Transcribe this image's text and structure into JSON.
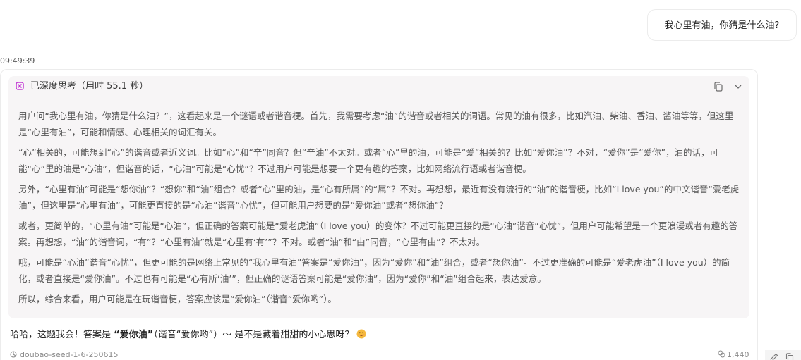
{
  "user_message": {
    "text": "我心里有油，你猜是什么油?"
  },
  "timestamp": "09:49:39",
  "thinking": {
    "label": "已深度思考（用时 55.1 秒）",
    "icon": "deep-thinking-icon",
    "paragraphs": [
      "用户问“我心里有油，你猜是什么油？”，这看起来是一个谜语或者谐音梗。首先，我需要考虑“油”的谐音或者相关的词语。常见的油有很多，比如汽油、柴油、香油、酱油等等，但这里是“心里有油”，可能和情感、心理相关的词汇有关。",
      "“心”相关的，可能想到“心”的谐音或者近义词。比如“心”和“辛”同音？但“辛油”不太对。或者“心”里的油，可能是“爱”相关的？比如“爱你油”？不对，“爱你”是“爱你”，油的话，可能“心”里的油是“心油”，但谐音的话，“心油”可能是“心忧”？不过用户可能是想要一个更有趣的答案，比如网络流行语或者谐音梗。",
      "另外，“心里有油”可能是“想你油”？“想你”和“油”组合？或者“心”里的油，是“心有所属”的“属”？不对。再想想，最近有没有流行的“油”的谐音梗，比如“I love you”的中文谐音“爱老虎油”，但这里是“心里有油”，可能更直接的是“心油”谐音“心忧”，但可能用户想要的是“爱你油”或者“想你油”？",
      "或者，更简单的，“心里有油”可能是“心油”，但正确的答案可能是“爱老虎油”（I love you）的变体？不过可能更直接的是“心油”谐音“心忧”，但用户可能希望是一个更浪漫或者有趣的答案。再想想，“油”的谐音词，“有”？“心里有油”就是“心里有‘有’”？不对。或者“油”和“由”同音，“心里有由”？不太对。",
      "哦，可能是“心油”谐音“心忧”，但更可能的是网络上常见的“我心里有油”答案是“爱你油”，因为“爱你”和“油”组合，或者“想你油”。不过更准确的可能是“爱老虎油”（I love you）的简化，或者直接是“爱你油”。不过也有可能是“心有所‘油’”，但正确的谜语答案可能是“爱你油”，因为“爱你”和“油”组合起来，表达爱意。",
      "所以，综合来看，用户可能是在玩谐音梗，答案应该是“爱你油”（谐音“爱你哟”）。"
    ]
  },
  "answer": {
    "prefix": "哈哈，这题我会！答案是 ",
    "highlight": "“爱你油”",
    "suffix": "（谐音“爱你哟”）～ 是不是藏着甜甜的小心思呀？",
    "emoji": "grinning-face-icon"
  },
  "footer": {
    "model": "doubao-seed-1-6-250615",
    "token_count": "1,440"
  },
  "colors": {
    "thinking_bg": "#f7f5f6",
    "thinking_icon": "#c23bd4",
    "thinking_text": "#555555",
    "emoji_face": "#f5b93d"
  }
}
